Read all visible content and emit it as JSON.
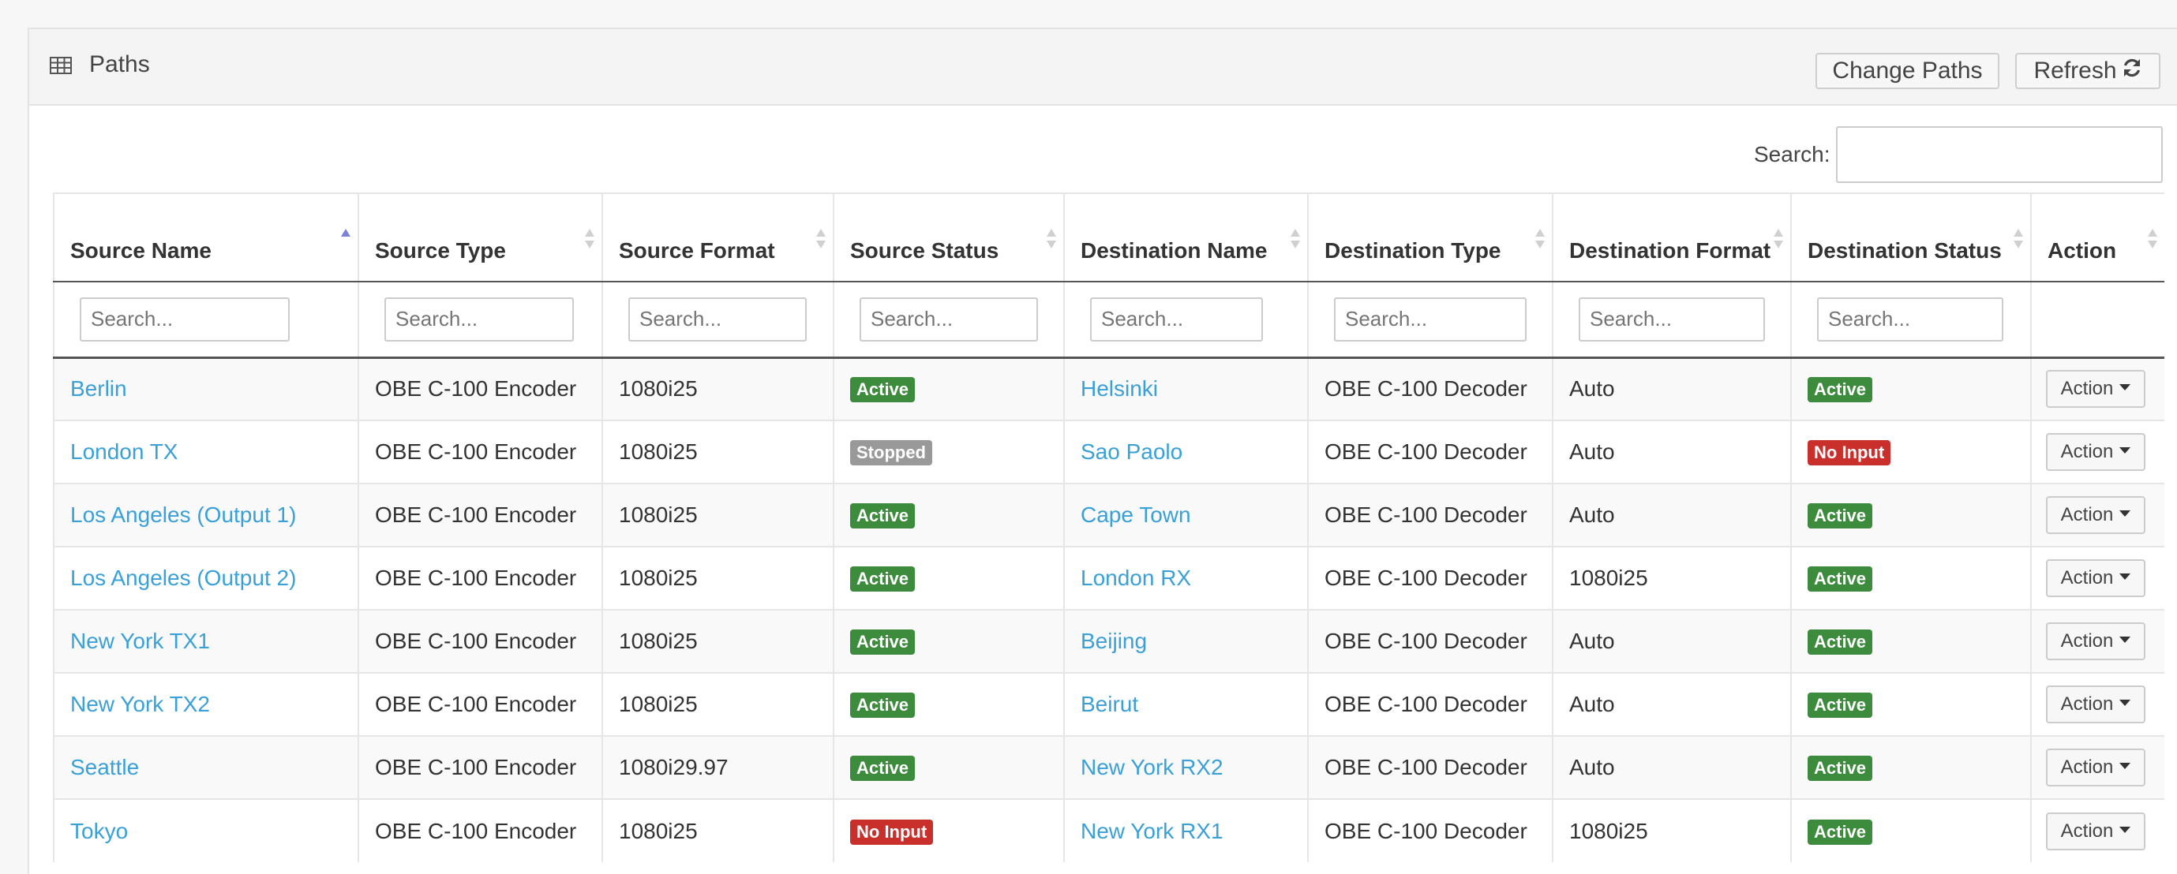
{
  "panel": {
    "title": "Paths",
    "icon": "table-icon",
    "change_paths_label": "Change Paths",
    "refresh_label": "Refresh",
    "refresh_icon": "refresh-icon"
  },
  "search": {
    "label": "Search:",
    "value": ""
  },
  "table": {
    "columns": [
      {
        "label": "Source Name",
        "sorted": "asc"
      },
      {
        "label": "Source Type"
      },
      {
        "label": "Source Format"
      },
      {
        "label": "Source Status"
      },
      {
        "label": "Destination Name"
      },
      {
        "label": "Destination Type"
      },
      {
        "label": "Destination Format"
      },
      {
        "label": "Destination Status"
      },
      {
        "label": "Action"
      }
    ],
    "filter_placeholder": "Search...",
    "rows": [
      {
        "source_name": "Berlin",
        "source_type": "OBE C-100 Encoder",
        "source_format": "1080i25",
        "source_status": "Active",
        "dest_name": "Helsinki",
        "dest_type": "OBE C-100 Decoder",
        "dest_format": "Auto",
        "dest_status": "Active",
        "action": "Action"
      },
      {
        "source_name": "London TX",
        "source_type": "OBE C-100 Encoder",
        "source_format": "1080i25",
        "source_status": "Stopped",
        "dest_name": "Sao Paolo",
        "dest_type": "OBE C-100 Decoder",
        "dest_format": "Auto",
        "dest_status": "No Input",
        "action": "Action"
      },
      {
        "source_name": "Los Angeles (Output 1)",
        "source_type": "OBE C-100 Encoder",
        "source_format": "1080i25",
        "source_status": "Active",
        "dest_name": "Cape Town",
        "dest_type": "OBE C-100 Decoder",
        "dest_format": "Auto",
        "dest_status": "Active",
        "action": "Action"
      },
      {
        "source_name": "Los Angeles (Output 2)",
        "source_type": "OBE C-100 Encoder",
        "source_format": "1080i25",
        "source_status": "Active",
        "dest_name": "London RX",
        "dest_type": "OBE C-100 Decoder",
        "dest_format": "1080i25",
        "dest_status": "Active",
        "action": "Action"
      },
      {
        "source_name": "New York TX1",
        "source_type": "OBE C-100 Encoder",
        "source_format": "1080i25",
        "source_status": "Active",
        "dest_name": "Beijing",
        "dest_type": "OBE C-100 Decoder",
        "dest_format": "Auto",
        "dest_status": "Active",
        "action": "Action"
      },
      {
        "source_name": "New York TX2",
        "source_type": "OBE C-100 Encoder",
        "source_format": "1080i25",
        "source_status": "Active",
        "dest_name": "Beirut",
        "dest_type": "OBE C-100 Decoder",
        "dest_format": "Auto",
        "dest_status": "Active",
        "action": "Action"
      },
      {
        "source_name": "Seattle",
        "source_type": "OBE C-100 Encoder",
        "source_format": "1080i29.97",
        "source_status": "Active",
        "dest_name": "New York RX2",
        "dest_type": "OBE C-100 Decoder",
        "dest_format": "Auto",
        "dest_status": "Active",
        "action": "Action"
      },
      {
        "source_name": "Tokyo",
        "source_type": "OBE C-100 Encoder",
        "source_format": "1080i25",
        "source_status": "No Input",
        "dest_name": "New York RX1",
        "dest_type": "OBE C-100 Decoder",
        "dest_format": "1080i25",
        "dest_status": "Active",
        "action": "Action"
      }
    ]
  },
  "status_colors": {
    "Active": "#3d8b3d",
    "Stopped": "#999999",
    "No Input": "#c9302c"
  },
  "link_color": "#3aa0d8"
}
